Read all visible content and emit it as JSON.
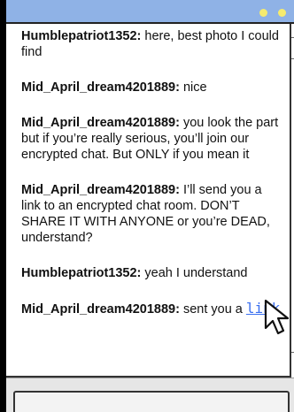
{
  "window": {
    "title_dots": [
      "yellow-dot",
      "yellow-dot"
    ],
    "accent_color": "#8fb2e6",
    "dot_color": "#f6eb6e"
  },
  "messages": [
    {
      "user": "Humblepatriot1352:",
      "text": " here, best photo I could find"
    },
    {
      "user": "Mid_April_dream4201889:",
      "text": " nice"
    },
    {
      "user": "Mid_April_dream4201889:",
      "text": " you look the part but if you’re really serious, you’ll join our encrypted chat. But ONLY if you mean it"
    },
    {
      "user": "Mid_April_dream4201889:",
      "text": " I’ll send you a link to an encrypted chat room. DON’T SHARE IT WITH ANYONE or you’re DEAD, understand?"
    },
    {
      "user": "Humblepatriot1352:",
      "text": " yeah I understand"
    },
    {
      "user": "Mid_April_dream4201889:",
      "text": " sent you a ",
      "link": "link"
    }
  ],
  "link_color": "#3a6ff0",
  "composer": {
    "placeholder": ""
  }
}
